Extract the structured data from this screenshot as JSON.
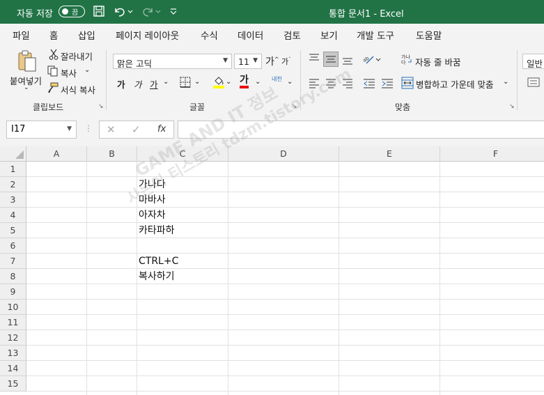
{
  "titlebar": {
    "autosave_label": "자동 저장",
    "autosave_state": "끔",
    "doc_title": "통합 문서1  -  Excel",
    "accent": "#217346"
  },
  "tabs": [
    "파일",
    "홈",
    "삽입",
    "페이지 레이아웃",
    "수식",
    "데이터",
    "검토",
    "보기",
    "개발 도구",
    "도움말"
  ],
  "active_tab": "홈",
  "ribbon": {
    "clipboard": {
      "paste": "붙여넣기",
      "cut": "잘라내기",
      "copy": "복사",
      "format_painter": "서식 복사",
      "label": "클립보드"
    },
    "font": {
      "font_name": "맑은 고딕",
      "font_size": "11",
      "grow": "가",
      "shrink": "가",
      "bold": "가",
      "italic": "가",
      "underline": "가",
      "font_color_glyph": "가",
      "phonetic": "내천",
      "label": "글꼴"
    },
    "alignment": {
      "wrap_text": "자동 줄 바꿈",
      "merge_center": "병합하고 가운데 맞춤",
      "label": "맞춤"
    },
    "number": {
      "format": "일반"
    }
  },
  "formula_bar": {
    "name_box": "I17",
    "fx": "fx",
    "value": ""
  },
  "sheet": {
    "columns": [
      "A",
      "B",
      "C",
      "D",
      "E",
      "F"
    ],
    "rows": [
      "1",
      "2",
      "3",
      "4",
      "5",
      "6",
      "7",
      "8",
      "9",
      "10",
      "11",
      "12",
      "13",
      "14",
      "15"
    ],
    "cells_c": {
      "c2": "가나다",
      "c3": "마바사",
      "c4": "아자차",
      "c5": "카타파하",
      "c7": "CTRL+C",
      "c8": "복사하기"
    }
  },
  "watermark": {
    "line1": "GAME AND IT 정보",
    "line2": "사는이 티스토리 tdzm.tistory.com"
  }
}
